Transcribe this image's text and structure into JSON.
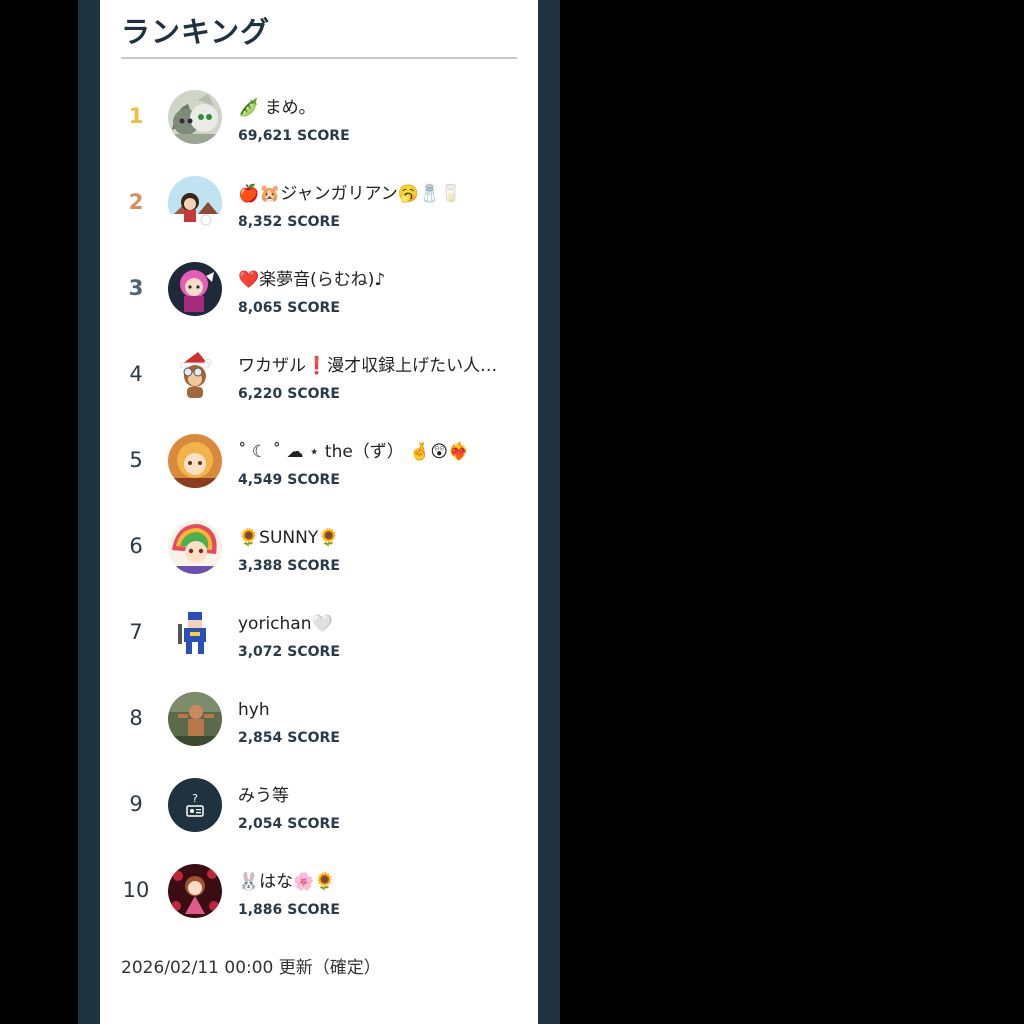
{
  "panel": {
    "heading": "ランキング",
    "score_unit": "SCORE",
    "footer_text": "2026/02/11 00:00 更新（確定）"
  },
  "rankings": [
    {
      "rank": "1",
      "name": "🫛 まめ。",
      "score": "69,621",
      "avatar": "cat-avatar-icon"
    },
    {
      "rank": "2",
      "name": "🍎🐹ジャンガリアン🥱🧂🥛",
      "score": "8,352",
      "avatar": "girl-winter-avatar-icon"
    },
    {
      "rank": "3",
      "name": "❤️楽夢音(らむね)♪",
      "score": "8,065",
      "avatar": "pink-hair-avatar-icon"
    },
    {
      "rank": "4",
      "name": "ワカザル❗️漫才収録上げたい人…",
      "score": "6,220",
      "avatar": "monkey-santa-avatar-icon"
    },
    {
      "rank": "5",
      "name": "˚ ☾ ˚ ☁︎ ⋆ the（ず） 🤞😲❤️‍🔥",
      "score": "4,549",
      "avatar": "blonde-girl-avatar-icon"
    },
    {
      "rank": "6",
      "name": "🌻SUNNY🌻",
      "score": "3,388",
      "avatar": "rainbow-hair-avatar-icon"
    },
    {
      "rank": "7",
      "name": "yorichan🤍",
      "score": "3,072",
      "avatar": "pixel-character-avatar-icon"
    },
    {
      "rank": "8",
      "name": "hyh",
      "score": "2,854",
      "avatar": "photo-person-avatar-icon"
    },
    {
      "rank": "9",
      "name": "みう等",
      "score": "2,054",
      "avatar": "radio-placeholder-avatar-icon"
    },
    {
      "rank": "10",
      "name": "🐰はな🌸🌻",
      "score": "1,886",
      "avatar": "flower-girl-avatar-icon"
    }
  ],
  "colors": {
    "frame": "#1f3240",
    "rank1": "#e6c13d",
    "rank2": "#de8c58",
    "rank3": "#4a6272"
  }
}
